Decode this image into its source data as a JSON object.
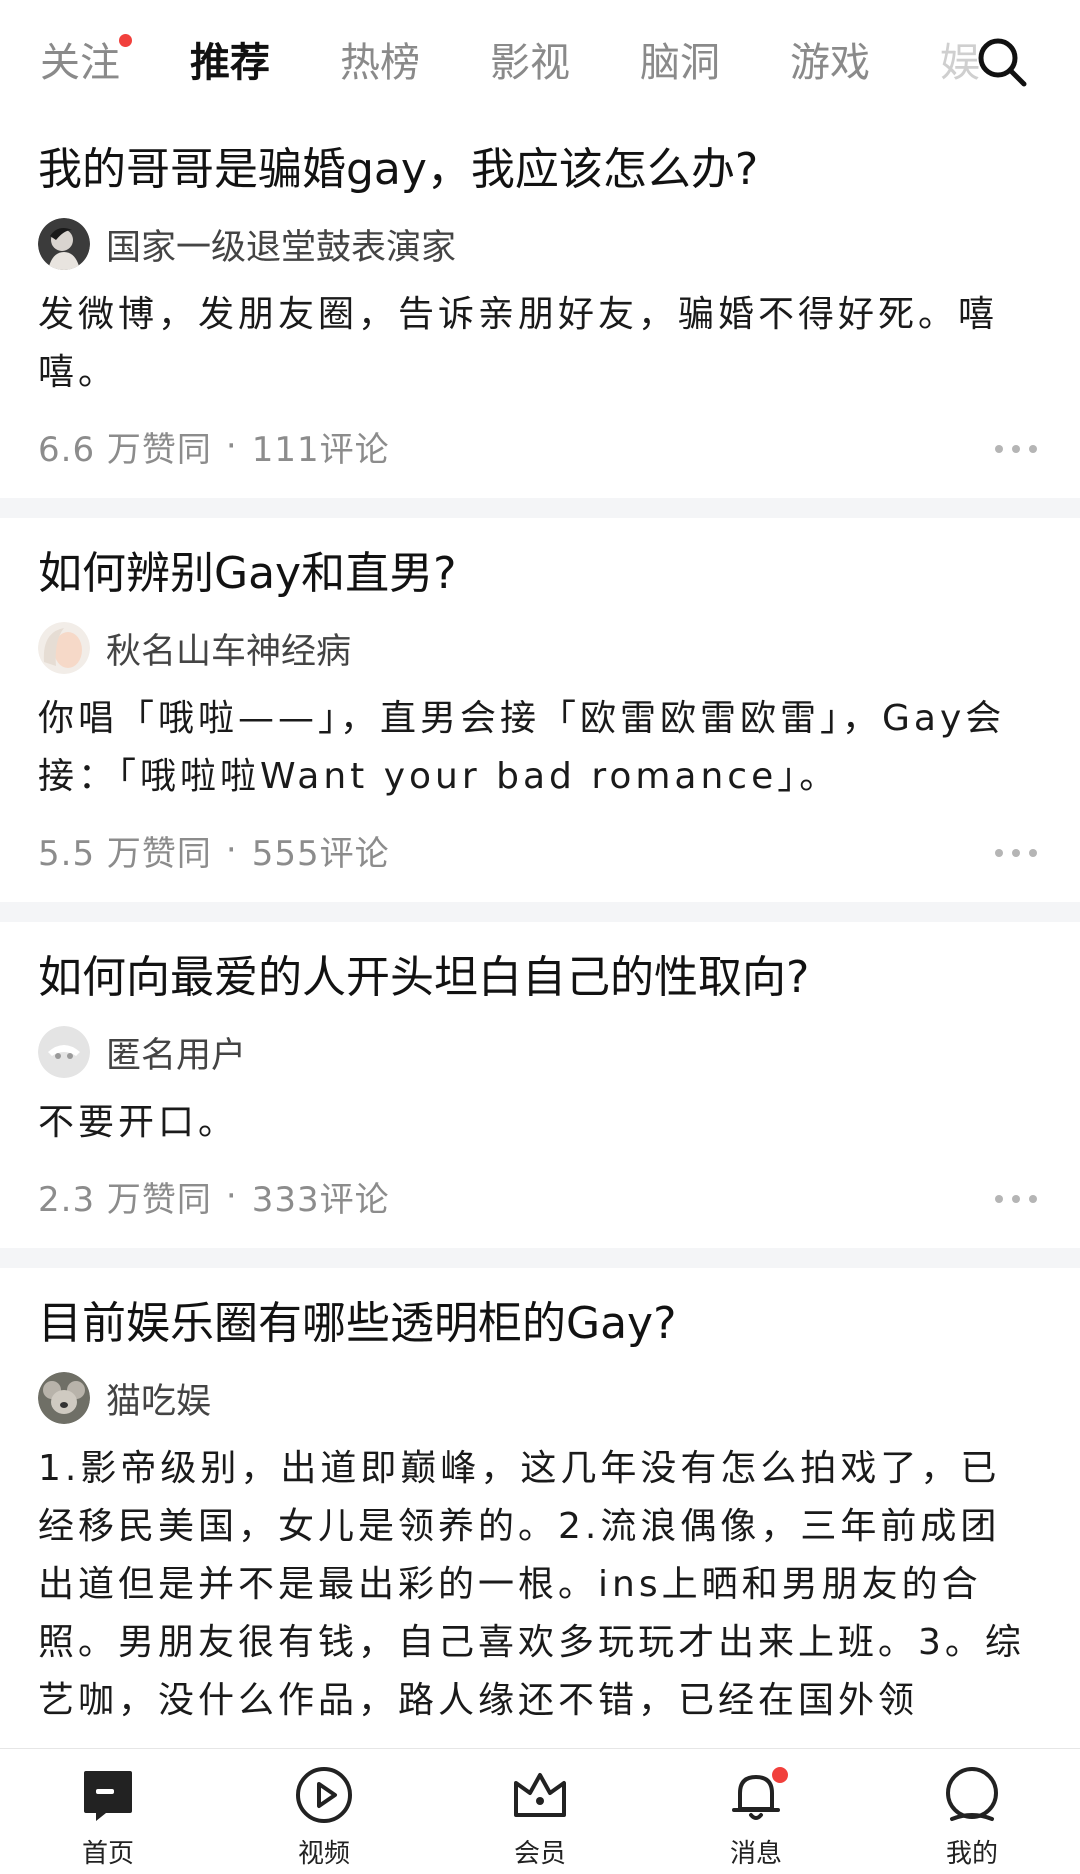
{
  "tabs": [
    {
      "label": "关注",
      "has_dot": true
    },
    {
      "label": "推荐",
      "active": true
    },
    {
      "label": "热榜"
    },
    {
      "label": "影视"
    },
    {
      "label": "脑洞"
    },
    {
      "label": "游戏"
    },
    {
      "label": "娱"
    }
  ],
  "colors": {
    "accent": "#0066ff",
    "notification_dot": "#f1403c",
    "muted": "#8c8c8c"
  },
  "feed": [
    {
      "title": "我的哥哥是骗婚gay，我应该怎么办?",
      "author": "国家一级退堂鼓表演家",
      "excerpt": "发微博，发朋友圈，告诉亲朋好友，骗婚不得好死。嘻嘻。",
      "likes": "6.6 万赞同",
      "separator": "·",
      "comments": "111评论"
    },
    {
      "title": "如何辨别Gay和直男?",
      "author": "秋名山车神经病",
      "excerpt": "你唱「哦啦——」，直男会接「欧雷欧雷欧雷」，Gay会接：「哦啦啦Want your bad romance」。",
      "likes": "5.5 万赞同",
      "separator": "·",
      "comments": "555评论"
    },
    {
      "title": "如何向最爱的人开头坦白自己的性取向?",
      "author": "匿名用户",
      "excerpt": "不要开口。",
      "likes": "2.3 万赞同",
      "separator": "·",
      "comments": "333评论"
    },
    {
      "title": "目前娱乐圈有哪些透明柜的Gay?",
      "author": "猫吃娱",
      "excerpt": "1.影帝级别，出道即巅峰，这几年没有怎么拍戏了，已经移民美国，女儿是领养的。2.流浪偶像，三年前成团出道但是并不是最出彩的一根。ins上晒和男朋友的合照。男朋友很有钱，自己喜欢多玩玩才出来上班。3。综艺咖，没什么作品，路人缘还不错，已经在国外领"
    }
  ],
  "bottom_nav": [
    {
      "label": "首页",
      "icon": "home-icon",
      "active": true
    },
    {
      "label": "视频",
      "icon": "play-icon"
    },
    {
      "label": "会员",
      "icon": "crown-icon"
    },
    {
      "label": "消息",
      "icon": "bell-icon",
      "has_dot": true
    },
    {
      "label": "我的",
      "icon": "profile-icon"
    }
  ]
}
